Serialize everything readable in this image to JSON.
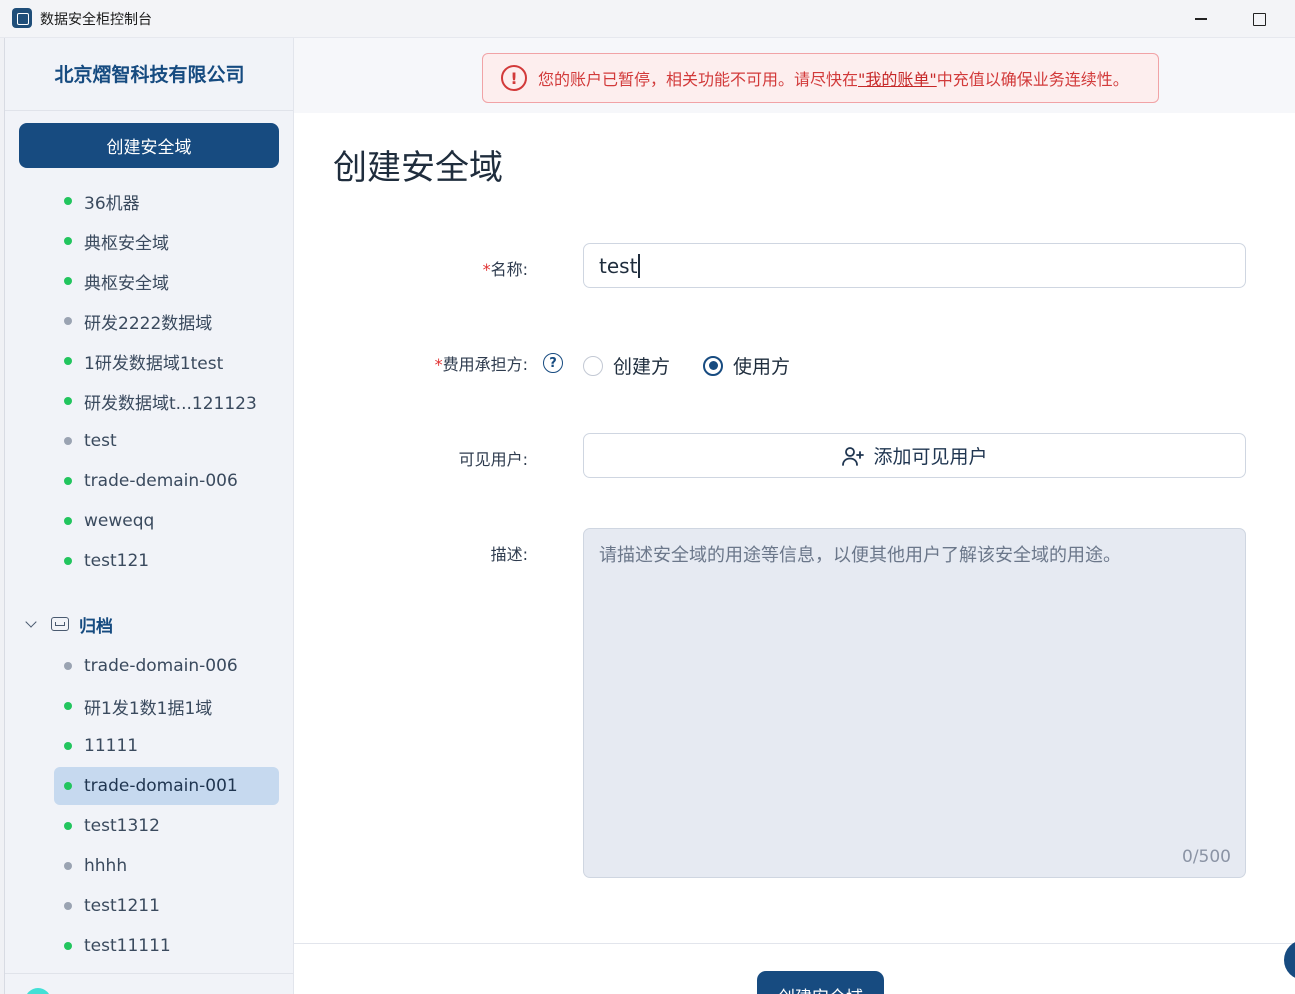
{
  "window": {
    "title": "数据安全柜控制台"
  },
  "sidebar": {
    "company": "北京熠智科技有限公司",
    "create_button": "创建安全域",
    "domains": [
      {
        "label": "36机器",
        "status": "active"
      },
      {
        "label": "典枢安全域",
        "status": "active"
      },
      {
        "label": "典枢安全域",
        "status": "active"
      },
      {
        "label": "研发2222数据域",
        "status": "inactive"
      },
      {
        "label": "1研发数据域1test",
        "status": "active"
      },
      {
        "label": "研发数据域t...121123",
        "status": "active"
      },
      {
        "label": "test",
        "status": "inactive"
      },
      {
        "label": "trade-demain-006",
        "status": "active"
      },
      {
        "label": "weweqq",
        "status": "active"
      },
      {
        "label": "test121",
        "status": "active"
      }
    ],
    "archive": {
      "label": "归档",
      "expanded": true,
      "items": [
        {
          "label": "trade-domain-006",
          "status": "inactive"
        },
        {
          "label": "研1发1数1据1域",
          "status": "active"
        },
        {
          "label": "11111",
          "status": "active"
        },
        {
          "label": "trade-domain-001",
          "status": "active",
          "selected": true
        },
        {
          "label": "test1312",
          "status": "active"
        },
        {
          "label": "hhhh",
          "status": "inactive"
        },
        {
          "label": "test1211",
          "status": "inactive"
        },
        {
          "label": "test11111",
          "status": "active"
        }
      ]
    }
  },
  "alert": {
    "text_before": "您的账户已暂停，相关功能不可用。请尽快在",
    "link": "\"我的账单\"",
    "text_after": "中充值以确保业务连续性。"
  },
  "form": {
    "title": "创建安全域",
    "name": {
      "required_mark": "*",
      "label": "名称:",
      "value": "test"
    },
    "cost_bearer": {
      "required_mark": "*",
      "label": "费用承担方:",
      "help_icon": "question-circle-icon",
      "options": [
        "创建方",
        "使用方"
      ],
      "selected": "使用方"
    },
    "visible_users": {
      "label": "可见用户:",
      "button": "添加可见用户",
      "icon": "user-plus-icon"
    },
    "description": {
      "label": "描述:",
      "placeholder": "请描述安全域的用途等信息，以便其他用户了解该安全域的用途。",
      "counter": "0/500"
    },
    "submit": "创建安全域"
  },
  "colors": {
    "primary": "#174b80",
    "active_dot": "#22c55e",
    "inactive_dot": "#9aa3b2",
    "alert_text": "#d23a3a",
    "alert_bg": "#fdeeee",
    "selected_bg": "#c6d9ef"
  }
}
